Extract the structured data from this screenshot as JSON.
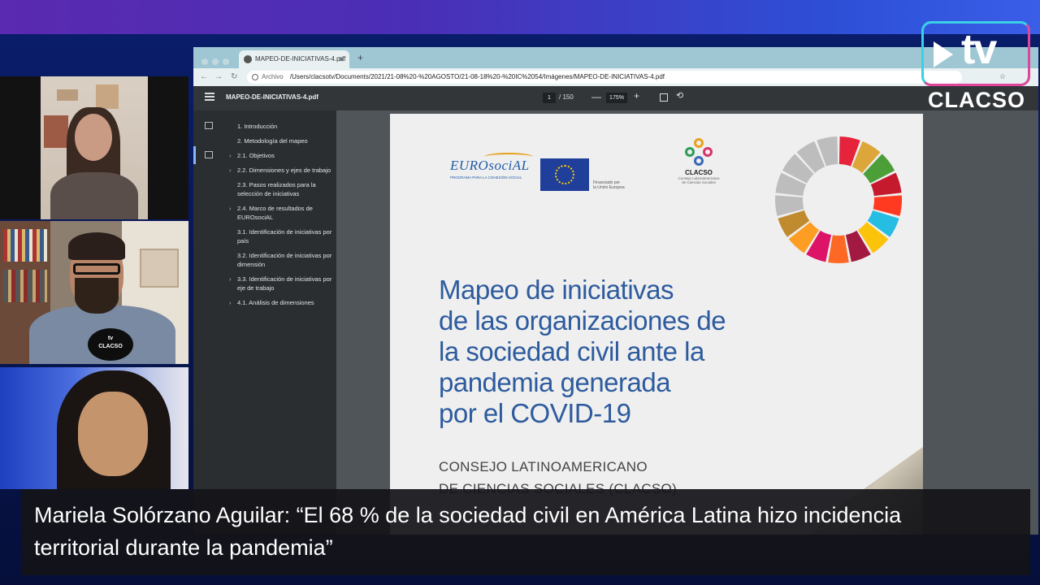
{
  "browser": {
    "tab_title": "MAPEO-DE-INICIATIVAS-4.pdf",
    "tab_close": "✕",
    "new_tab": "+",
    "address_label": "Archivo",
    "url": "/Users/clacsotv/Documents/2021/21-08%20-%20AGOSTO/21-08-18%20-%20IC%2054/Imágenes/MAPEO-DE-INICIATIVAS-4.pdf"
  },
  "pdf_toolbar": {
    "title": "MAPEO-DE-INICIATIVAS-4.pdf",
    "page_current": "1",
    "page_total": "/ 150",
    "zoom_minus": "—",
    "zoom": "175%",
    "zoom_plus": "+"
  },
  "outline": [
    {
      "label": "1. Introducción",
      "chevron": ""
    },
    {
      "label": "2. Metodología del mapeo",
      "chevron": ""
    },
    {
      "label": "2.1. Objetivos",
      "chevron": "›"
    },
    {
      "label": "2.2. Dimensiones y ejes de trabajo",
      "chevron": "›"
    },
    {
      "label": "2.3. Pasos realizados para la selección de iniciativas",
      "chevron": ""
    },
    {
      "label": "2.4. Marco de resultados de EUROsociAL",
      "chevron": "›"
    },
    {
      "label": "3.1. Identificación de iniciativas por país",
      "chevron": ""
    },
    {
      "label": "3.2. Identificación de iniciativas por dimensión",
      "chevron": ""
    },
    {
      "label": "3.3. Identificación de iniciativas por eje de trabajo",
      "chevron": "›"
    },
    {
      "label": "4.1. Análisis de dimensiones",
      "chevron": "›"
    }
  ],
  "document": {
    "eurosocial_name": "EUROsociAL",
    "eurosocial_sub": "PROGRAMA PARA LA COHESIÓN SOCIAL",
    "eu_text_1": "Financiado por",
    "eu_text_2": "la Unión Europea",
    "clacso_name": "CLACSO",
    "clacso_sub_1": "Consejo Latinoamericano",
    "clacso_sub_2": "de Ciencias Sociales",
    "title_lines": [
      "Mapeo de iniciativas",
      "de las organizaciones de",
      "la sociedad civil ante la",
      "pandemia generada",
      "por el COVID-19"
    ],
    "org_line_1": "CONSEJO LATINOAMERICANO",
    "org_line_2": "DE CIENCIAS SOCIALES (CLACSO)"
  },
  "overlay": {
    "tv_logo": "tv",
    "brand": "CLACSO",
    "mic_tv": "tv",
    "mic_brand": "CLACSO"
  },
  "caption": {
    "line_1": "Mariela Solórzano Aguilar: “El 68 % de la sociedad civil en América Latina hizo incidencia",
    "line_2": "territorial durante la pandemia”"
  },
  "colors": {
    "title_blue": "#2d5b9e",
    "caption_bg": "#141418",
    "accent_cyan": "#3ad0e6",
    "accent_pink": "#e0459b"
  }
}
